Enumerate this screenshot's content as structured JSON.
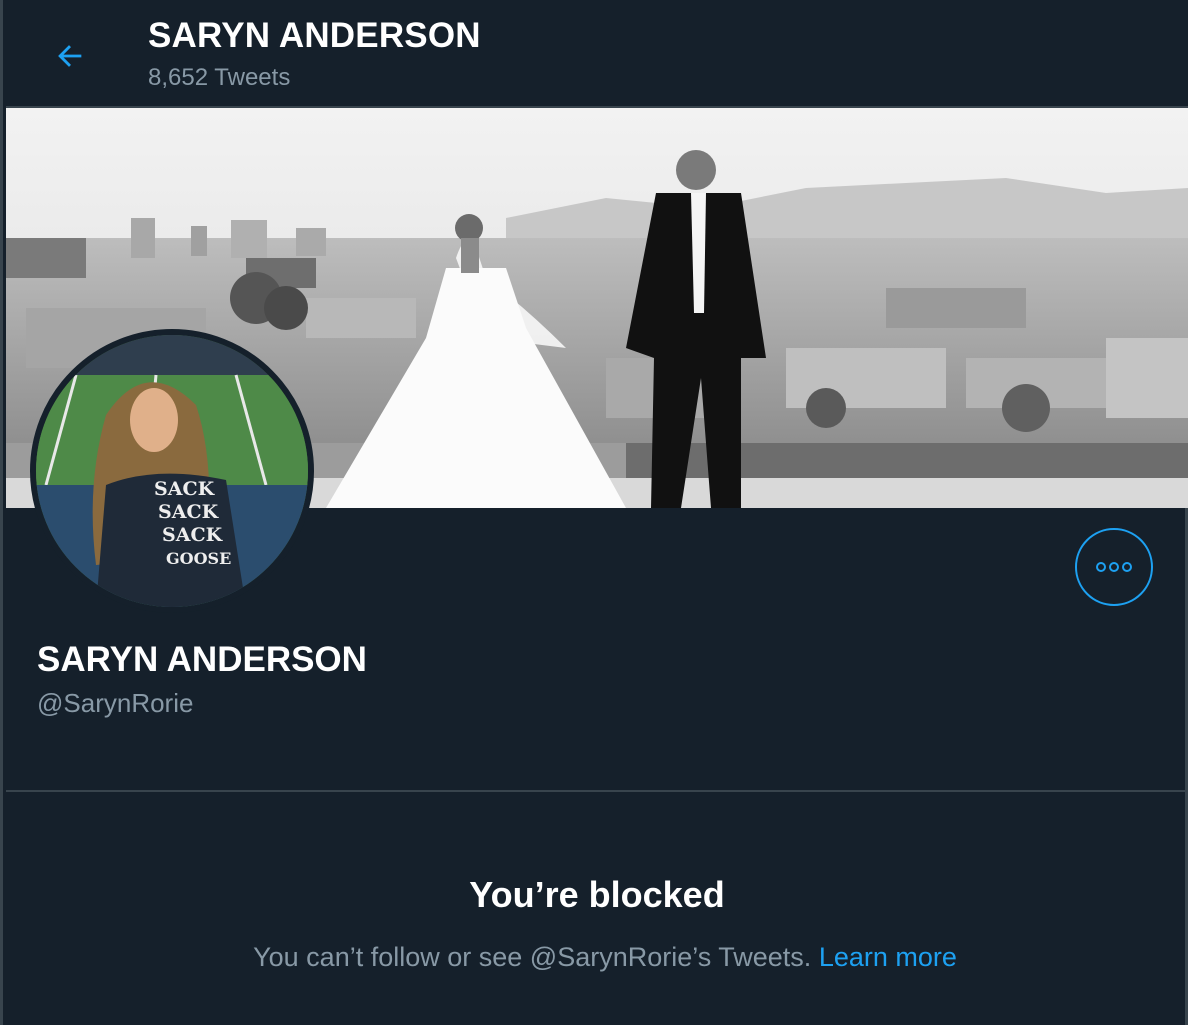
{
  "header": {
    "name": "SARYN ANDERSON",
    "tweet_count": "8,652 Tweets",
    "back_icon": "arrow-left-icon"
  },
  "profile": {
    "name": "SARYN ANDERSON",
    "handle": "@SarynRorie",
    "more_icon": "more-horizontal-icon",
    "avatar_shirt_lines": [
      "SACK",
      "SACK",
      "SACK",
      "GOOSE"
    ]
  },
  "blocked": {
    "title": "You’re blocked",
    "message": "You can’t follow or see @SarynRorie’s Tweets.",
    "link": "Learn more"
  },
  "colors": {
    "background": "#15202b",
    "border": "#38444d",
    "accent": "#1da1f2",
    "secondary_text": "#8899a6"
  }
}
